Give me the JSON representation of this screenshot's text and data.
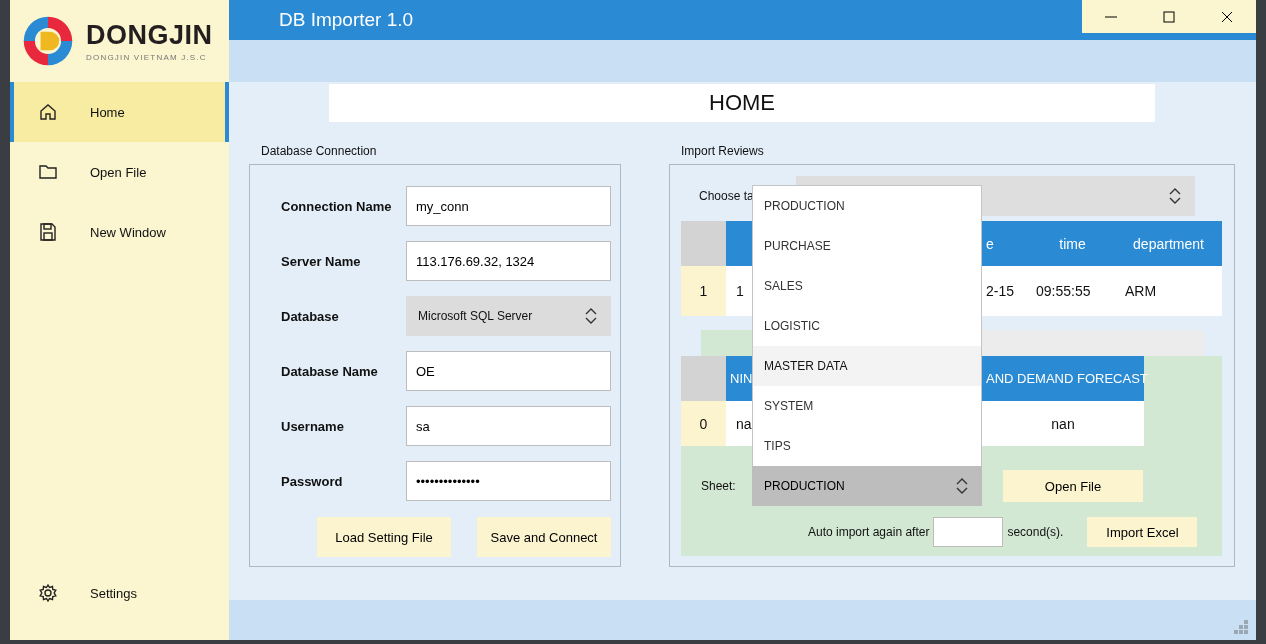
{
  "window": {
    "title": "DB Importer 1.0"
  },
  "logo": {
    "name": "DONGJIN",
    "tagline": "DONGJIN VIETNAM J.S.C"
  },
  "sidebar": {
    "items": [
      {
        "label": "Home",
        "kind": "home",
        "selected": true
      },
      {
        "label": "Open File",
        "kind": "folder",
        "selected": false
      },
      {
        "label": "New Window",
        "kind": "save",
        "selected": false
      }
    ],
    "footer": [
      {
        "label": "Settings",
        "kind": "settings",
        "selected": false
      }
    ]
  },
  "page_title": "HOME",
  "database_connection": {
    "title": "Database Connection",
    "fields": [
      {
        "label": "Connection Name",
        "kind": "text",
        "value": "my_conn"
      },
      {
        "label": "Server Name",
        "kind": "text",
        "value": "113.176.69.32, 1324"
      },
      {
        "label": "Database",
        "kind": "select",
        "value": "Microsoft SQL Server"
      },
      {
        "label": "Database Name",
        "kind": "text",
        "value": "OE"
      },
      {
        "label": "Username",
        "kind": "text",
        "value": "sa"
      },
      {
        "label": "Password",
        "kind": "password",
        "value": "••••••••••••••"
      }
    ],
    "buttons": [
      "Load Setting File",
      "Save and Connect"
    ]
  },
  "import_reviews": {
    "title": "Import Reviews",
    "table_label": "Choose ta",
    "review_table": {
      "columns": [
        {},
        {
          "label": "e"
        },
        {
          "label": "time"
        },
        {
          "label": "department"
        }
      ],
      "rows": [
        {
          "index": "1",
          "cells": [
            "1",
            "2-15",
            "09:55:55",
            "ARM"
          ]
        }
      ]
    },
    "sheet_table": {
      "columns": [
        {
          "label": "NIN"
        },
        {
          "label": "AND DEMAND FORECAST"
        }
      ],
      "rows": [
        {
          "index": "0",
          "cells": [
            "na",
            "nan"
          ]
        }
      ]
    },
    "sheet": {
      "label": "Sheet:",
      "value": "PRODUCTION",
      "expanded": true,
      "options": [
        {
          "label": "PRODUCTION",
          "highlighted": false
        },
        {
          "label": "PURCHASE",
          "highlighted": false
        },
        {
          "label": "SALES",
          "highlighted": false
        },
        {
          "label": "LOGISTIC",
          "highlighted": false
        },
        {
          "label": "MASTER DATA",
          "highlighted": true
        },
        {
          "label": "SYSTEM",
          "highlighted": false
        },
        {
          "label": "TIPS",
          "highlighted": false
        }
      ]
    },
    "open_button": "Open File",
    "auto_import": {
      "before": "Auto import again after",
      "after": "second(s)."
    },
    "import_button": "Import Excel"
  }
}
